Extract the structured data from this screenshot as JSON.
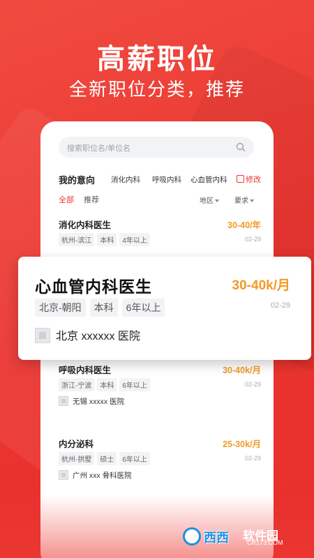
{
  "hero": {
    "title": "高薪职位",
    "subtitle": "全新职位分类，推荐"
  },
  "search": {
    "placeholder": "搜索职位名/单位名"
  },
  "intent": {
    "label": "我的意向",
    "items": [
      "消化内科",
      "呼吸内科",
      "心血管内科"
    ],
    "modify": "修改"
  },
  "tabs": {
    "items": [
      "全部",
      "推荐"
    ],
    "active": "全部",
    "filters": [
      "地区",
      "要求"
    ]
  },
  "jobs": [
    {
      "title": "消化内科医生",
      "salary": "30-40/年",
      "tags": [
        "杭州-滨江",
        "本科",
        "4年以上"
      ],
      "date": "02-29"
    },
    {
      "title": "呼吸内科医生",
      "salary": "30-40k/月",
      "tags": [
        "浙江-宁波",
        "本科",
        "6年以上"
      ],
      "date": "02-29",
      "company": "无锡 xxxxx 医院"
    },
    {
      "title": "内分泌科",
      "salary": "25-30k/月",
      "tags": [
        "杭州-拱墅",
        "硕士",
        "6年以上"
      ],
      "date": "02-29",
      "company": "广州 xxx 骨科医院"
    }
  ],
  "featured_job": {
    "title": "心血管内科医生",
    "salary": "30-40k/月",
    "tags": [
      "北京-朝阳",
      "本科",
      "6年以上"
    ],
    "date": "02-29",
    "company": "北京 xxxxxx 医院"
  },
  "watermark": {
    "text": "西西",
    "brand": "软件园",
    "url": "CR173.COM"
  },
  "colors": {
    "accent": "#e8352f",
    "salary": "#f29a25",
    "background": "#ec3a35"
  }
}
